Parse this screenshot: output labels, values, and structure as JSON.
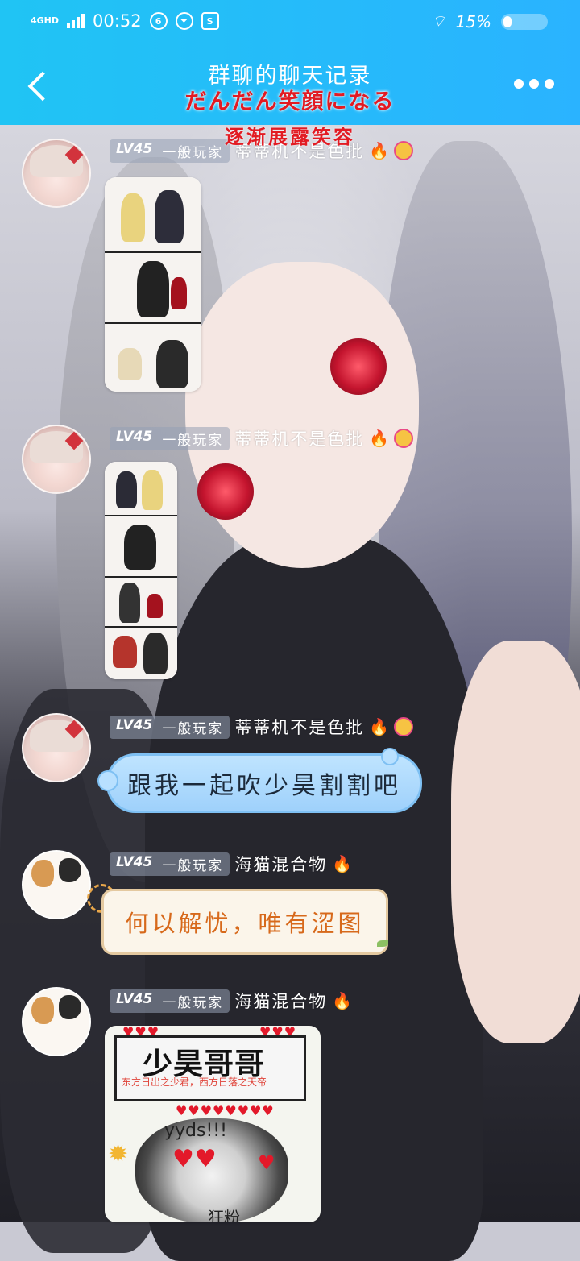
{
  "status_bar": {
    "network": "4GHD",
    "time": "00:52",
    "battery": "15%"
  },
  "header": {
    "title": "群聊的聊天记录",
    "subtitle": "だんだん笑顔になる",
    "overlay_caption": "逐渐展露笑容"
  },
  "messages": [
    {
      "level": "LV45",
      "rank": "一般玩家",
      "nickname": "蒂蒂机不是色批",
      "avatar": "anime-girl",
      "type": "image"
    },
    {
      "level": "LV45",
      "rank": "一般玩家",
      "nickname": "蒂蒂机不是色批",
      "avatar": "anime-girl",
      "type": "image"
    },
    {
      "level": "LV45",
      "rank": "一般玩家",
      "nickname": "蒂蒂机不是色批",
      "avatar": "anime-girl",
      "type": "text",
      "text": "跟我一起吹少昊割割吧"
    },
    {
      "level": "LV45",
      "rank": "一般玩家",
      "nickname": "海猫混合物",
      "avatar": "calico-cat",
      "type": "text",
      "text": "何以解忧，唯有涩图"
    },
    {
      "level": "LV45",
      "rank": "一般玩家",
      "nickname": "海猫混合物",
      "avatar": "calico-cat",
      "type": "sticker",
      "sticker_title": "少昊哥哥",
      "sticker_subtitle": "东方日出之少君，西方日落之天帝",
      "sticker_text": "yyds!!!",
      "sticker_caption": "狂粉"
    }
  ],
  "colors": {
    "header_bg": "#2ab3ff",
    "subtitle_red": "#e21b23",
    "bubble_blue": "#bfe4ff",
    "bubble_cream": "#fbf5ea",
    "cream_text": "#d7691b"
  },
  "icons": {
    "back": "chevron-left-icon",
    "more": "more-dots-icon",
    "fire": "fire-icon",
    "smile": "smile-badge-icon"
  }
}
